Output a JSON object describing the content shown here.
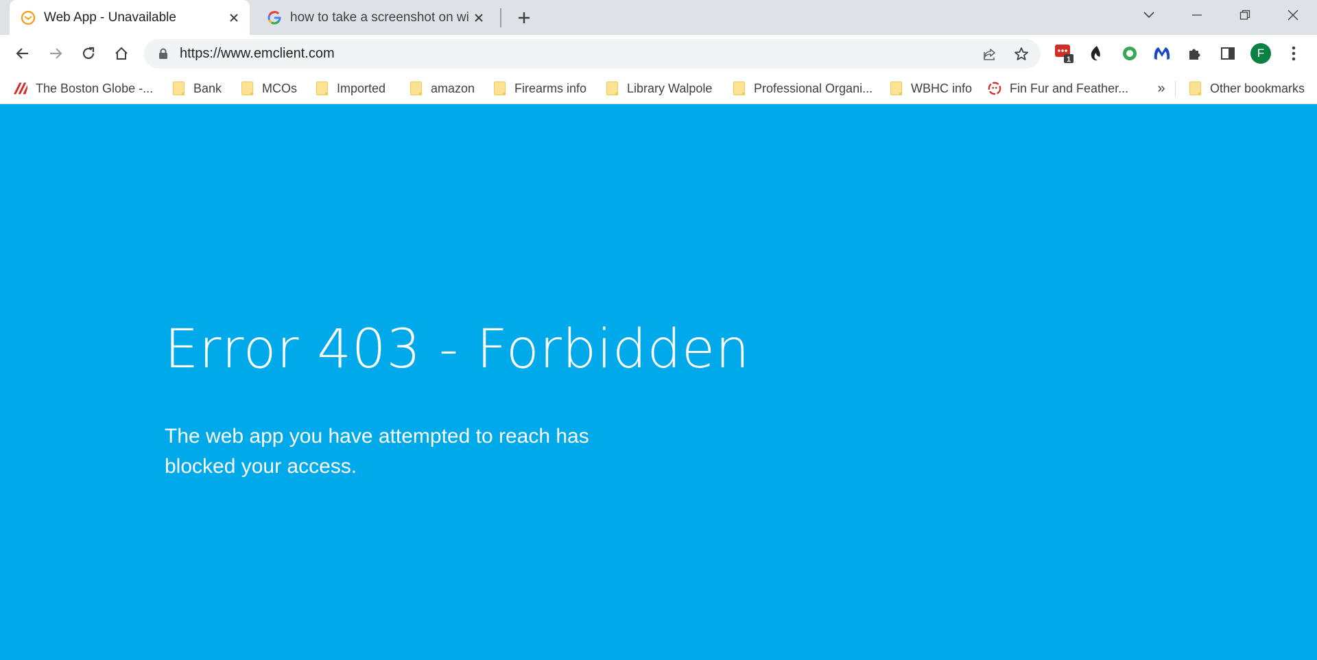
{
  "tabs": [
    {
      "title": "Web App - Unavailable",
      "favicon": "emclient-envelope-icon",
      "active": true
    },
    {
      "title": "how to take a screenshot on windows",
      "favicon": "google-g-icon",
      "active": false
    }
  ],
  "omnibox": {
    "url": "https://www.emclient.com"
  },
  "extensions": {
    "badge_count": "1",
    "profile_initial": "F"
  },
  "bookmarks": [
    {
      "label": "The Boston Globe -...",
      "icon": "boston-globe-icon"
    },
    {
      "label": "Bank",
      "icon": "folder-icon"
    },
    {
      "label": "MCOs",
      "icon": "folder-icon"
    },
    {
      "label": "Imported",
      "icon": "folder-icon"
    },
    {
      "label": "amazon",
      "icon": "folder-icon"
    },
    {
      "label": "Firearms info",
      "icon": "folder-icon"
    },
    {
      "label": "Library Walpole",
      "icon": "folder-icon"
    },
    {
      "label": "Professional Organi...",
      "icon": "folder-icon"
    },
    {
      "label": "WBHC info",
      "icon": "folder-icon"
    },
    {
      "label": "Fin Fur and Feather...",
      "icon": "fin-fur-feather-icon"
    }
  ],
  "bookmarks_overflow": "»",
  "other_bookmarks": "Other bookmarks",
  "page": {
    "title": "Error 403 - Forbidden",
    "message": "The web app you have attempted to reach has blocked your access."
  },
  "colors": {
    "page_background": "#00a9ea",
    "tabstrip": "#dee1e6",
    "avatar": "#0b8043"
  }
}
